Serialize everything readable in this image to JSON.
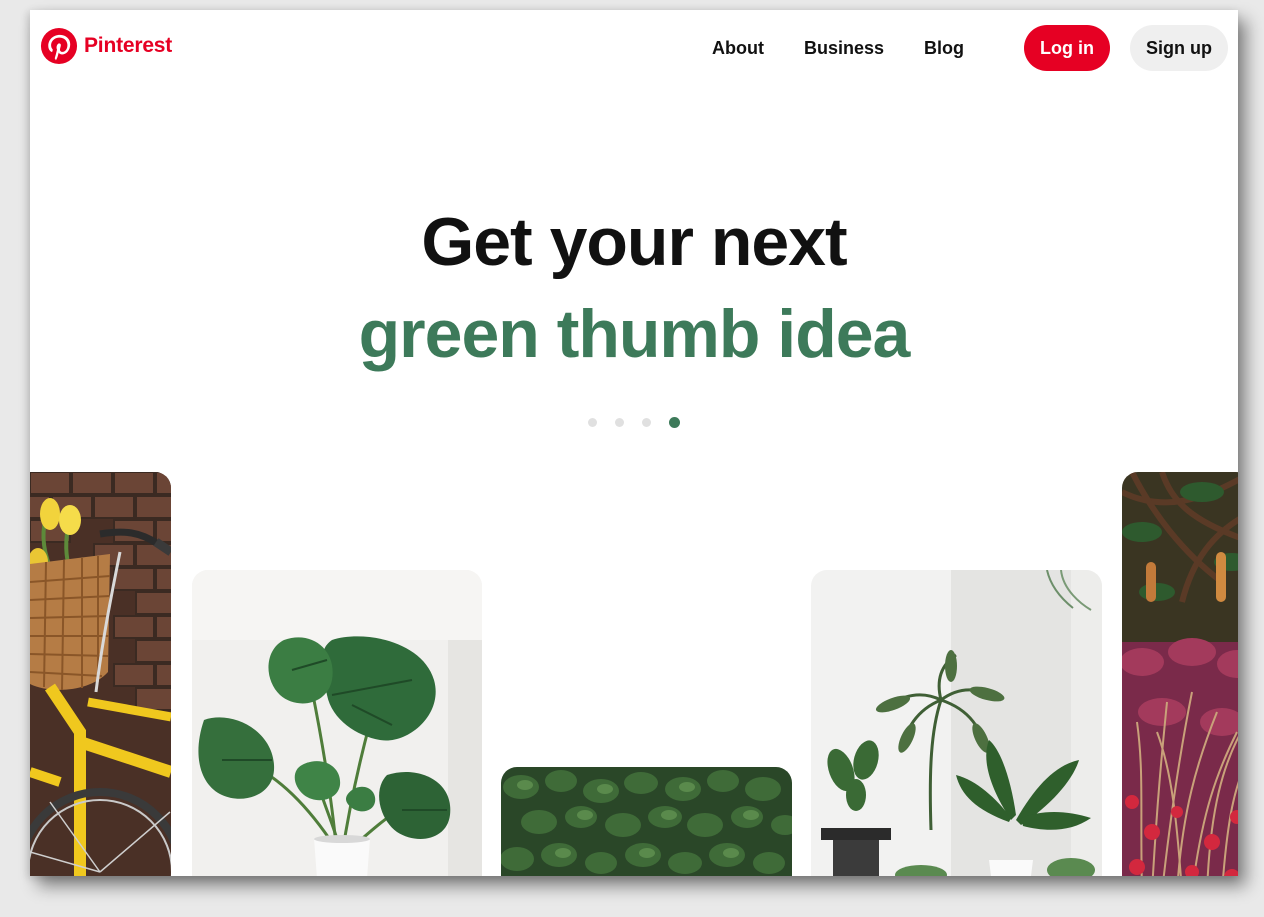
{
  "header": {
    "brand": "Pinterest",
    "logo_icon": "pinterest-p-logo-icon",
    "nav": {
      "about": "About",
      "business": "Business",
      "blog": "Blog"
    },
    "login_label": "Log in",
    "signup_label": "Sign up"
  },
  "hero": {
    "line1": "Get your next",
    "line2": "green thumb idea",
    "carousel": {
      "total_slides": 4,
      "active_slide": 4
    }
  },
  "tiles": [
    {
      "name": "yellow-bicycle-basket-image"
    },
    {
      "name": "monstera-plant-image"
    },
    {
      "name": "leafy-hedge-image"
    },
    {
      "name": "indoor-plants-room-image"
    },
    {
      "name": "red-grass-garden-image"
    }
  ],
  "colors": {
    "brand_red": "#e60023",
    "accent_green": "#3d7a5a",
    "text_dark": "#111111",
    "signup_bg": "#efefef"
  }
}
